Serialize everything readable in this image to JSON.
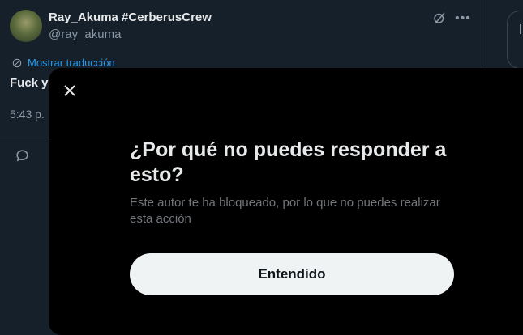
{
  "tweet": {
    "display_name": "Ray_Akuma #CerberusCrew",
    "handle": "@ray_akuma",
    "translate_label": "Mostrar traducción",
    "text_visible": "Fuck y",
    "time_visible": "5:43 p."
  },
  "icons": {
    "grok": "grok-icon",
    "more": "more-icon",
    "translate": "translate-icon",
    "reply": "reply-icon",
    "close": "close-icon"
  },
  "modal": {
    "title": "¿Por qué no puedes responder a esto?",
    "body": "Este autor te ha bloqueado, por lo que no puedes realizar esta acción",
    "button_label": "Entendido"
  },
  "colors": {
    "background": "#15202b",
    "modal_background": "#000000",
    "accent": "#1d9bf0",
    "button_background": "#eff3f4"
  }
}
